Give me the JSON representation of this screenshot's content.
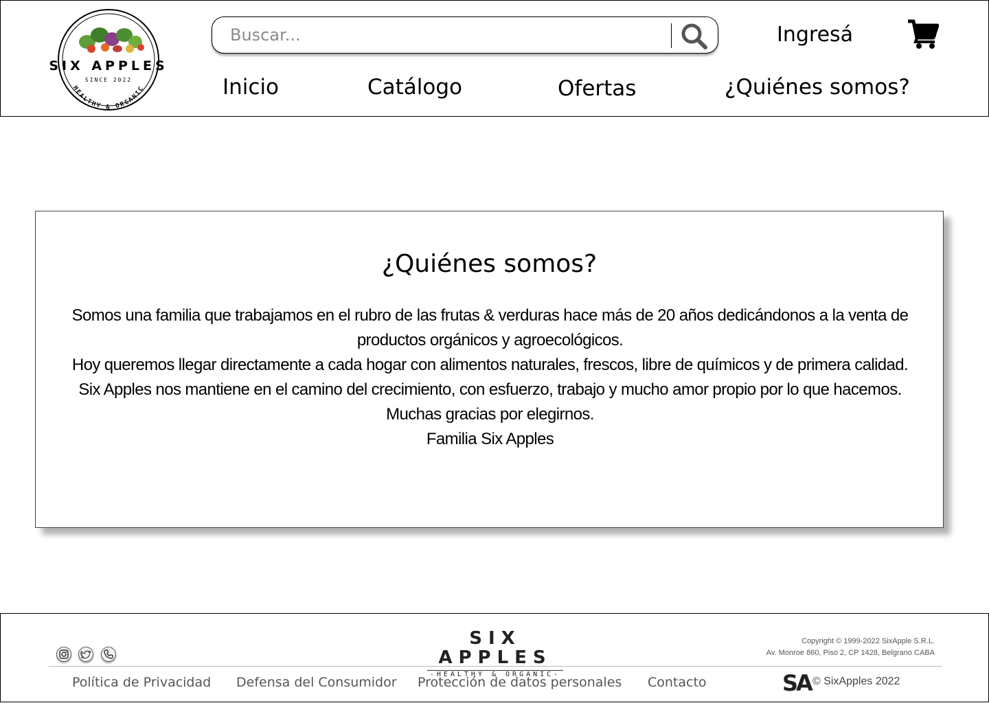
{
  "header": {
    "logo": {
      "brand": "SIX APPLES",
      "since": "SINCE 2022",
      "tagline": "HEALTHY & ORGANIC"
    },
    "search": {
      "placeholder": "Buscar...",
      "value": ""
    },
    "login_label": "Ingresá",
    "nav": [
      "Inicio",
      "Catálogo",
      "Ofertas",
      "¿Quiénes somos?"
    ]
  },
  "about": {
    "title": "¿Quiénes somos?",
    "paragraphs": [
      "Somos una familia que trabajamos en el rubro de las frutas & verduras hace más de 20 años dedicándonos a la venta de productos orgánicos y agroecológicos.",
      "Hoy queremos llegar directamente a cada hogar con alimentos naturales, frescos, libre de químicos y de primera calidad.",
      "Six Apples nos mantiene en el camino del crecimiento, con esfuerzo, trabajo y mucho amor propio por lo que hacemos.",
      "Muchas gracias por elegirnos.",
      "Familia Six Apples"
    ]
  },
  "footer": {
    "social_icons": [
      "instagram-icon",
      "twitter-icon",
      "phone-icon"
    ],
    "brand": "SIX APPLES",
    "brand_tagline": "-HEALTHY & ORGANIC-",
    "legal_line1": "Copyright © 1999-2022 SixApple S.R.L.",
    "legal_line2": "Av. Monroe 860, Piso 2, CP 1428, Belgrano CABA",
    "links": [
      "Política de Privacidad",
      "Defensa del Consumidor",
      "Protección de datos personales",
      "Contacto"
    ],
    "mark": "SA",
    "copyright": "© SixApples 2022"
  },
  "colors": {
    "text": "#000000",
    "muted": "#555555",
    "border": "#000000"
  }
}
